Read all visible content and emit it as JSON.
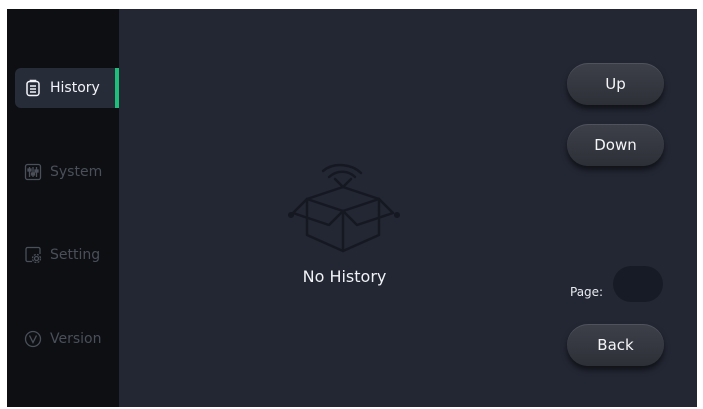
{
  "sidebar": {
    "items": [
      {
        "label": "History",
        "icon": "clipboard-icon",
        "active": true
      },
      {
        "label": "System",
        "icon": "sliders-icon",
        "active": false
      },
      {
        "label": "Setting",
        "icon": "settings-icon",
        "active": false
      },
      {
        "label": "Version",
        "icon": "version-icon",
        "active": false
      }
    ]
  },
  "main": {
    "empty_icon": "empty-box-icon",
    "empty_text": "No History"
  },
  "controls": {
    "up_label": "Up",
    "down_label": "Down",
    "page_label": "Page:",
    "page_value": "",
    "back_label": "Back"
  },
  "colors": {
    "background": "#232733",
    "sidebar": "#0d0f13",
    "active_item": "#262c38",
    "accent": "#1dbf7a",
    "inactive_text": "#4a4f59",
    "button": "#34373f"
  }
}
